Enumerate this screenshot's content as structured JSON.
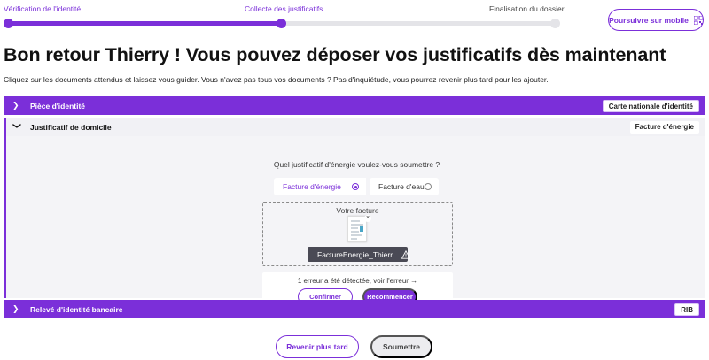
{
  "stepper": {
    "steps": [
      {
        "label": "Vérification de l'identité",
        "state": "done"
      },
      {
        "label": "Collecte des justificatifs",
        "state": "current"
      },
      {
        "label": "Finalisation du dossier",
        "state": "todo"
      }
    ]
  },
  "header": {
    "mobile_button_label": "Poursuivre sur mobile",
    "mobile_button_icon": "qr-code-icon"
  },
  "page": {
    "title": "Bon retour Thierry ! Vous pouvez déposer vos justificatifs dès maintenant",
    "subtitle": "Cliquez sur les documents attendus et laissez vous guider. Vous n'avez pas tous vos documents ? Pas d'inquiétude, vous pourrez revenir plus tard pour les ajouter."
  },
  "sections": [
    {
      "title": "Pièce d'identité",
      "badge": "Carte nationale d'identité",
      "expanded": false
    },
    {
      "title": "Justificatif de domicile",
      "badge": "Facture d'énergie",
      "expanded": true
    },
    {
      "title": "Relevé d'identité bancaire",
      "badge": "RIB",
      "expanded": false
    }
  ],
  "domicile": {
    "question": "Quel justificatif d'énergie voulez-vous soumettre ?",
    "options": [
      {
        "label": "Facture d'énergie",
        "selected": true
      },
      {
        "label": "Facture d'eau",
        "selected": false
      }
    ],
    "dropzone_label": "Votre facture",
    "thumbnail_close": "×",
    "file_name": "FactureEnergie_Thierr",
    "error_text": "1 erreur a été détectée, voir l'erreur →",
    "confirm_label": "Confirmer",
    "restart_label": "Recommencer"
  },
  "footer": {
    "later_label": "Revenir plus tard",
    "submit_label": "Soumettre"
  },
  "colors": {
    "accent": "#7b2fd9",
    "track": "#e4e4e8",
    "panel": "#f4f4f7",
    "file_pill": "#4a4a55"
  }
}
